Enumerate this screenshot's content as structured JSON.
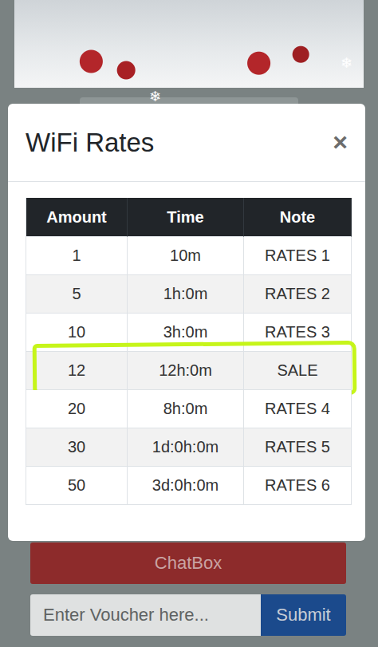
{
  "snowflakes": [
    "❄",
    "❄"
  ],
  "dialog": {
    "title": "WiFi Rates",
    "close": "×"
  },
  "table": {
    "columns": [
      "Amount",
      "Time",
      "Note"
    ],
    "rows": [
      {
        "cells": [
          "1",
          "10m",
          "RATES 1"
        ],
        "highlighted": false
      },
      {
        "cells": [
          "5",
          "1h:0m",
          "RATES 2"
        ],
        "highlighted": false
      },
      {
        "cells": [
          "10",
          "3h:0m",
          "RATES 3"
        ],
        "highlighted": false
      },
      {
        "cells": [
          "12",
          "12h:0m",
          "SALE"
        ],
        "highlighted": true
      },
      {
        "cells": [
          "20",
          "8h:0m",
          "RATES 4"
        ],
        "highlighted": false
      },
      {
        "cells": [
          "30",
          "1d:0h:0m",
          "RATES 5"
        ],
        "highlighted": false
      },
      {
        "cells": [
          "50",
          "3d:0h:0m",
          "RATES 6"
        ],
        "highlighted": false
      }
    ]
  },
  "chatbox": {
    "label": "ChatBox"
  },
  "voucher": {
    "placeholder": "Enter Voucher here...",
    "submit": "Submit"
  }
}
